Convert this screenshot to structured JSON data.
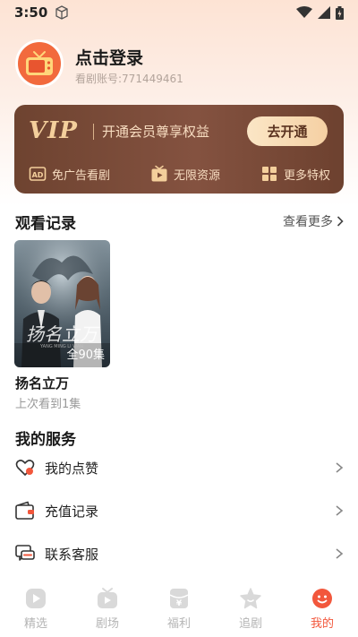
{
  "status_bar": {
    "time": "3:50"
  },
  "profile": {
    "title": "点击登录",
    "account_id": "看剧账号:771449461"
  },
  "vip": {
    "logo": "VIP",
    "description": "开通会员尊享权益",
    "button_label": "去开通",
    "features": [
      {
        "label": "免广告看剧",
        "icon": "ad-icon"
      },
      {
        "label": "无限资源",
        "icon": "play-tv-icon"
      },
      {
        "label": "更多特权",
        "icon": "grid-icon"
      }
    ]
  },
  "history": {
    "title": "观看记录",
    "view_more": "查看更多",
    "items": [
      {
        "title": "扬名立万",
        "episodes": "全90集",
        "progress": "上次看到1集"
      }
    ]
  },
  "services": {
    "title": "我的服务",
    "items": [
      {
        "label": "我的点赞",
        "icon": "heart-icon"
      },
      {
        "label": "充值记录",
        "icon": "wallet-icon"
      },
      {
        "label": "联系客服",
        "icon": "chat-icon"
      }
    ]
  },
  "nav": {
    "items": [
      {
        "label": "精选",
        "icon": "play-circle-icon"
      },
      {
        "label": "剧场",
        "icon": "tv-icon"
      },
      {
        "label": "福利",
        "icon": "gift-icon"
      },
      {
        "label": "追剧",
        "icon": "star-icon"
      },
      {
        "label": "我的",
        "icon": "smiley-icon",
        "active": true
      }
    ]
  },
  "colors": {
    "accent": "#f2573c",
    "vip_bg": "#7a4b37",
    "vip_gold": "#f4cf9c"
  }
}
